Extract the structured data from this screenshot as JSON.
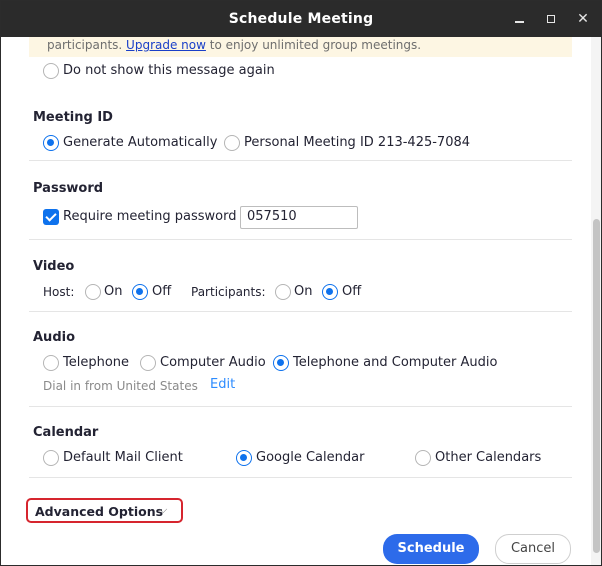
{
  "window": {
    "title": "Schedule Meeting",
    "controls": {
      "minimize": "minimize-icon",
      "maximize": "maximize-icon",
      "close": "✕"
    }
  },
  "banner": {
    "text_before": "participants. ",
    "link": "Upgrade now",
    "text_after": " to enjoy unlimited group meetings.",
    "dont_show_label": "Do not show this message again",
    "dont_show_checked": false
  },
  "meeting_id": {
    "heading": "Meeting ID",
    "options": [
      {
        "label": "Generate Automatically",
        "checked": true
      },
      {
        "label": "Personal Meeting ID 213-425-7084",
        "checked": false
      }
    ]
  },
  "password": {
    "heading": "Password",
    "require_label": "Require meeting password",
    "require_checked": true,
    "value": "057510"
  },
  "video": {
    "heading": "Video",
    "host_label": "Host:",
    "host_on": "On",
    "host_off": "Off",
    "host_selected": "Off",
    "participants_label": "Participants:",
    "participants_on": "On",
    "participants_off": "Off",
    "participants_selected": "Off"
  },
  "audio": {
    "heading": "Audio",
    "options": [
      {
        "label": "Telephone",
        "checked": false
      },
      {
        "label": "Computer Audio",
        "checked": false
      },
      {
        "label": "Telephone and Computer Audio",
        "checked": true
      }
    ],
    "dial_in": "Dial in from United States",
    "edit": "Edit"
  },
  "calendar": {
    "heading": "Calendar",
    "options": [
      {
        "label": "Default Mail Client",
        "checked": false
      },
      {
        "label": "Google Calendar",
        "checked": true
      },
      {
        "label": "Other Calendars",
        "checked": false
      }
    ]
  },
  "advanced": {
    "label": "Advanced Options",
    "chevron": "⌵"
  },
  "actions": {
    "schedule": "Schedule",
    "cancel": "Cancel"
  },
  "colors": {
    "accent": "#0e72ed",
    "primary_button": "#2d6bea",
    "highlight_border": "#d6252e",
    "titlebar": "#2b2b2b",
    "link": "#2d8cff"
  }
}
